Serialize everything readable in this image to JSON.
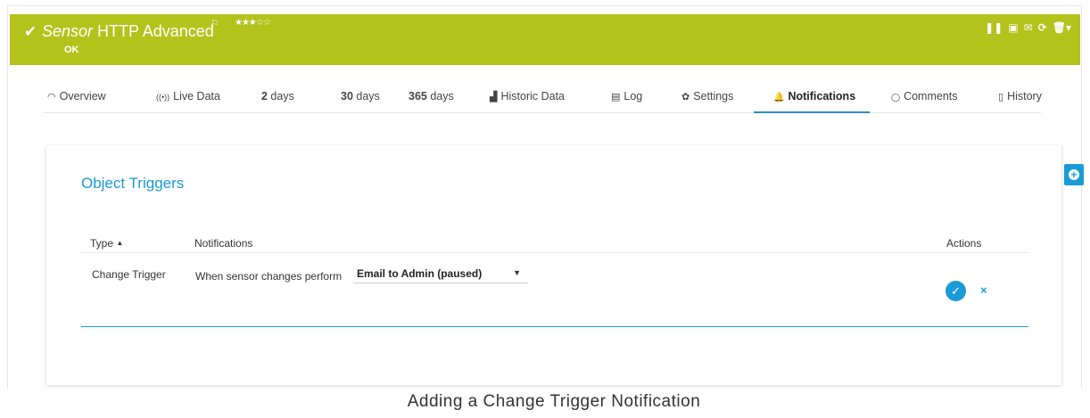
{
  "header": {
    "sensor_word": "Sensor",
    "title_rest": " HTTP Advanced",
    "status": "OK",
    "stars": "★★★☆☆",
    "check_icon": "check-icon",
    "flag_icon": "flag-icon",
    "bg_color": "#b4c21c",
    "tools": [
      "pause-icon",
      "export-icon",
      "email-icon",
      "refresh-icon",
      "delete-icon"
    ]
  },
  "tabs": [
    {
      "label": "Overview",
      "icon": "◠"
    },
    {
      "label": "Live Data",
      "icon": "((•))"
    },
    {
      "num": "2",
      "label": " days"
    },
    {
      "num": "30",
      "label": " days"
    },
    {
      "num": "365",
      "label": " days"
    },
    {
      "label": "Historic Data",
      "icon": "▟"
    },
    {
      "label": "Log",
      "icon": "▤"
    },
    {
      "label": "Settings",
      "icon": "✿"
    },
    {
      "label": "Notifications",
      "icon": "🔔"
    },
    {
      "label": "Comments",
      "icon": "◯"
    },
    {
      "label": "History",
      "icon": "▯"
    }
  ],
  "card": {
    "title": "Object Triggers",
    "columns": {
      "type": "Type",
      "sort_arrow": "▲",
      "notifications": "Notifications",
      "actions": "Actions"
    },
    "row": {
      "type": "Change Trigger",
      "prefix": "When sensor changes perform",
      "selected": "Email to Admin (paused)"
    }
  },
  "caption": "Adding a Change Trigger Notification",
  "accent_color": "#1a9bd7"
}
